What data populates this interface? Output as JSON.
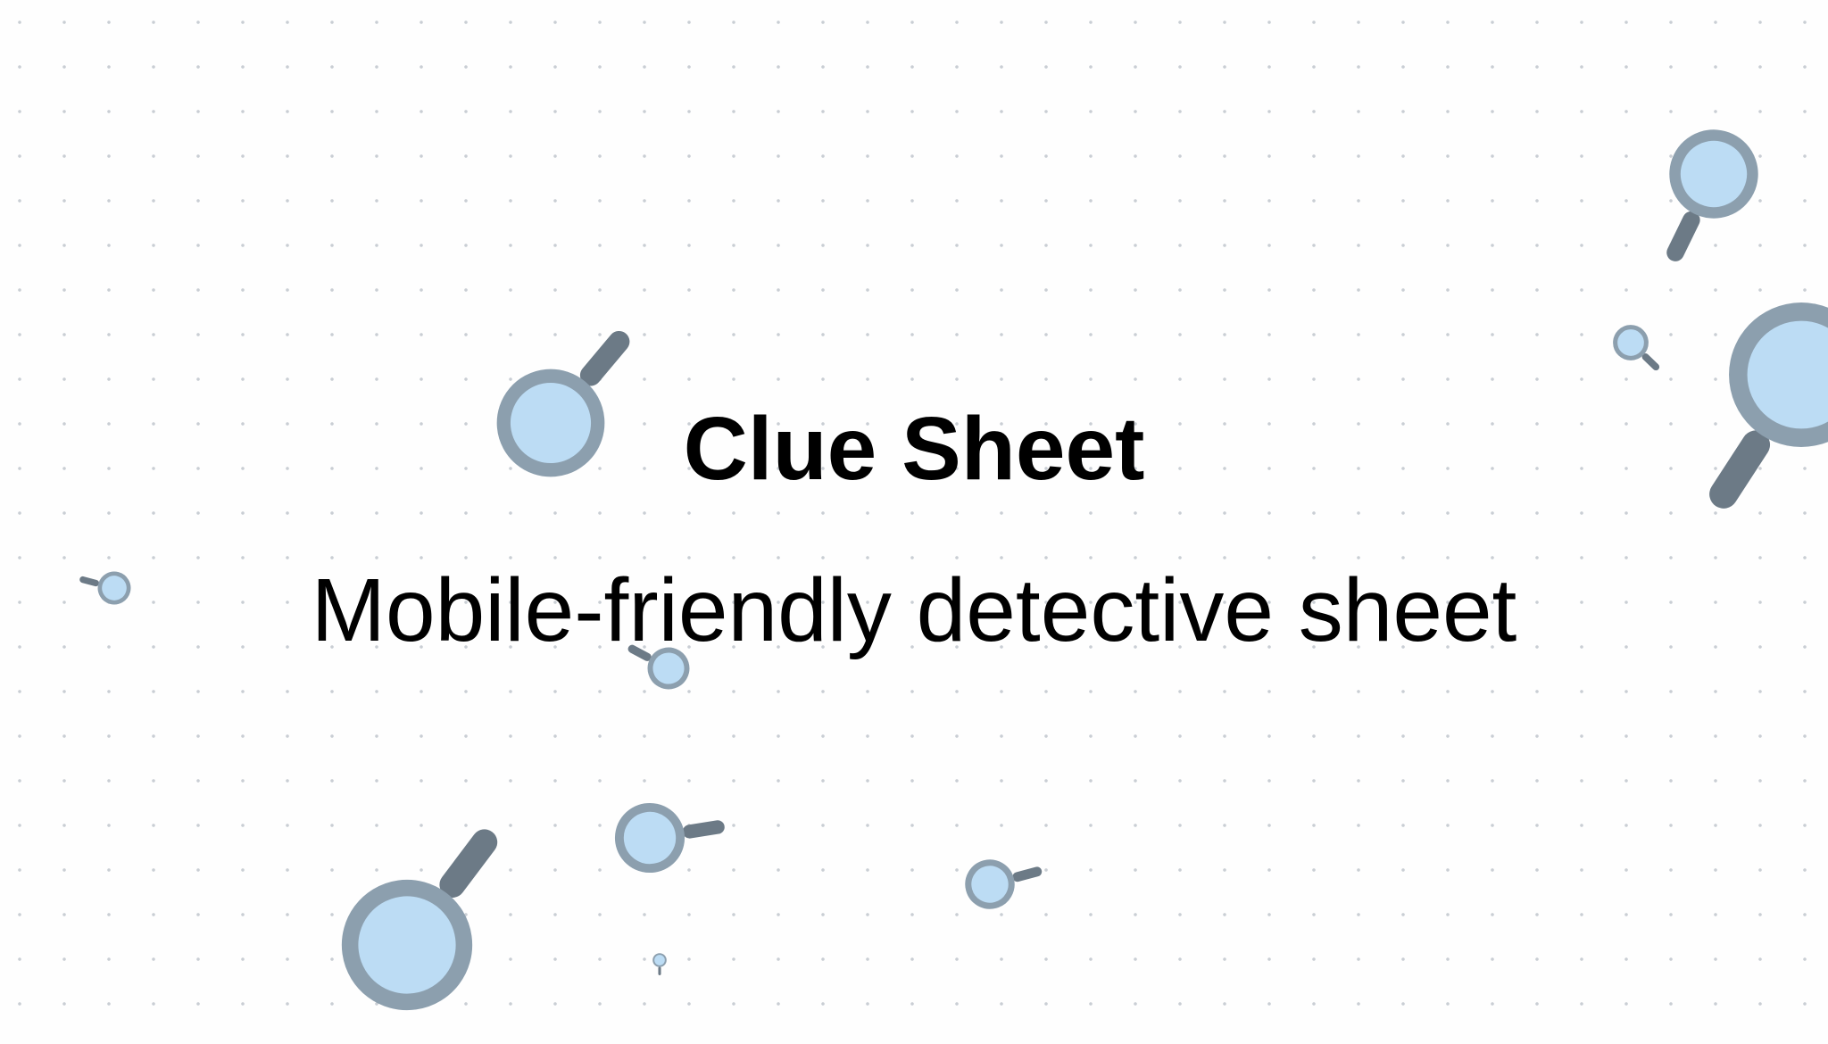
{
  "title": "Clue Sheet",
  "subtitle": "Mobile-friendly detective sheet",
  "colors": {
    "background": "#fefefe",
    "dot": "#c9ced4",
    "lens_fill": "#bcdcf4",
    "lens_rim": "#8c9fae",
    "handle": "#6c7a86",
    "text": "#000000"
  },
  "decorations": {
    "icon": "magnifying-glass-icon"
  }
}
